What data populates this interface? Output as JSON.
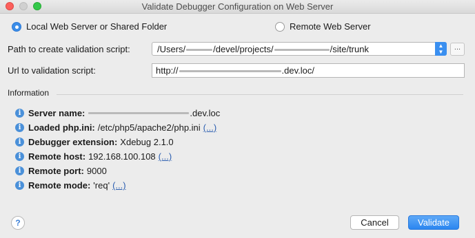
{
  "window": {
    "title": "Validate Debugger Configuration on Web Server"
  },
  "mode": {
    "local_label": "Local Web Server or Shared Folder",
    "remote_label": "Remote Web Server",
    "selected": "local"
  },
  "path": {
    "label": "Path to create validation script:",
    "value_prefix": "/Users/",
    "value_middle": "/devel/projects/",
    "value_suffix": "/site/trunk",
    "browse_label": "..."
  },
  "url": {
    "label": "Url to validation script:",
    "value_prefix": "http://",
    "value_suffix": ".dev.loc/"
  },
  "information": {
    "title": "Information",
    "server_name": {
      "key": "Server name:",
      "value": ".dev.loc"
    },
    "loaded_php_ini": {
      "key": "Loaded php.ini:",
      "value": "/etc/php5/apache2/php.ini",
      "link": "(...)"
    },
    "debugger_extension": {
      "key": "Debugger extension:",
      "value": "Xdebug 2.1.0"
    },
    "remote_host": {
      "key": "Remote host:",
      "value": "192.168.100.108",
      "link": "(...)"
    },
    "remote_port": {
      "key": "Remote port:",
      "value": "9000"
    },
    "remote_mode": {
      "key": "Remote mode:",
      "value": "'req'",
      "link": "(...)"
    }
  },
  "buttons": {
    "help": "?",
    "cancel": "Cancel",
    "validate": "Validate"
  },
  "colors": {
    "accent": "#3a8ff0",
    "info_icon": "#4a90d9",
    "link": "#2a5db0"
  }
}
